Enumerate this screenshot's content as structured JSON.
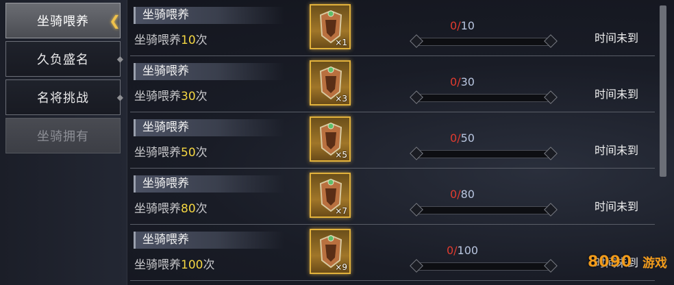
{
  "sidebar": {
    "tabs": [
      {
        "label": "坐骑喂养",
        "state": "active"
      },
      {
        "label": "久负盛名",
        "state": "normal"
      },
      {
        "label": "名将挑战",
        "state": "normal"
      },
      {
        "label": "坐骑拥有",
        "state": "disabled"
      }
    ]
  },
  "tasks": [
    {
      "title": "坐骑喂养",
      "desc_prefix": "坐骑喂养",
      "desc_num": "10",
      "desc_suffix": "次",
      "item_count": "×1",
      "current": "0",
      "sep": "/",
      "max": "10",
      "progress": 0,
      "status": "时间未到"
    },
    {
      "title": "坐骑喂养",
      "desc_prefix": "坐骑喂养",
      "desc_num": "30",
      "desc_suffix": "次",
      "item_count": "×3",
      "current": "0",
      "sep": "/",
      "max": "30",
      "progress": 0,
      "status": "时间未到"
    },
    {
      "title": "坐骑喂养",
      "desc_prefix": "坐骑喂养",
      "desc_num": "50",
      "desc_suffix": "次",
      "item_count": "×5",
      "current": "0",
      "sep": "/",
      "max": "50",
      "progress": 0,
      "status": "时间未到"
    },
    {
      "title": "坐骑喂养",
      "desc_prefix": "坐骑喂养",
      "desc_num": "80",
      "desc_suffix": "次",
      "item_count": "×7",
      "current": "0",
      "sep": "/",
      "max": "80",
      "progress": 0,
      "status": "时间未到"
    },
    {
      "title": "坐骑喂养",
      "desc_prefix": "坐骑喂养",
      "desc_num": "100",
      "desc_suffix": "次",
      "item_count": "×9",
      "current": "0",
      "sep": "/",
      "max": "100",
      "progress": 0,
      "status": "时间未到"
    }
  ],
  "watermark": {
    "logo": "8090",
    "site": "游戏"
  },
  "colors": {
    "accent_gold": "#f0c24b",
    "progress_current": "#e23b2f",
    "highlight_number": "#f5d742"
  }
}
